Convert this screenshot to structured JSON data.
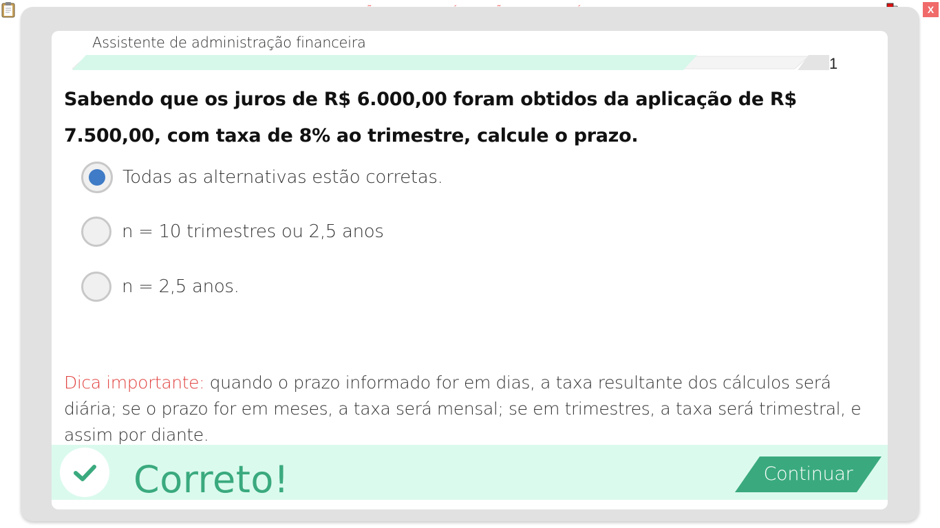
{
  "window": {
    "banner": "VERSÃO PARA FUNCIONÁRIOS - NÃO COMERCIALIZÁVEL",
    "close_label": "X",
    "icons": [
      "clipboard-icon",
      "network-status-icon"
    ]
  },
  "header": {
    "module_title": "Assistente de administração financeira",
    "progress_fraction": 0.83,
    "question_number": "1"
  },
  "question": {
    "text": "Sabendo que os juros de R$ 6.000,00 foram obtidos da aplicação de R$ 7.500,00, com taxa de 8% ao trimestre, calcule o prazo."
  },
  "options": [
    {
      "label": "Todas as alternativas estão corretas.",
      "selected": true
    },
    {
      "label": "n = 10 trimestres ou 2,5 anos",
      "selected": false
    },
    {
      "label": "n = 2,5 anos.",
      "selected": false
    }
  ],
  "tip": {
    "label": "Dica importante:",
    "text": "quando o prazo informado for em dias, a taxa resultante dos cálculos será diária; se o prazo for em meses, a taxa será mensal; se em trimestres, a taxa será trimestral, e assim por diante."
  },
  "feedback": {
    "status": "Correto!",
    "icon": "check-icon",
    "continue_label": "Continuar"
  },
  "colors": {
    "accent_green": "#3aaa7e",
    "feedback_bg": "#dbfaee",
    "progress_fill": "#d6f8ea",
    "selected_radio": "#3f7bc6",
    "tip_label": "#e0423f",
    "banner_red": "#f06a6a"
  }
}
